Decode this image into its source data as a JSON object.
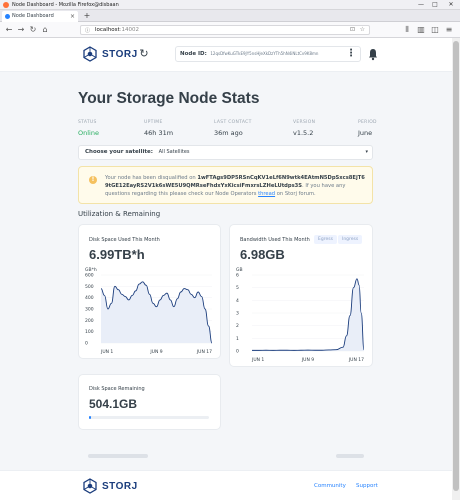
{
  "window": {
    "title": "Node Dashboard - Mozilla Firefox@disbaan",
    "min": "—",
    "max": "□",
    "close": "✕"
  },
  "browser": {
    "tab_title": "Node Dashboard",
    "tab_close": "×",
    "new_tab": "+",
    "url_host": "localhost",
    "url_port": ":14002",
    "back": "←",
    "forward": "→",
    "reload": "↻",
    "home": "⌂",
    "bookmark": "☆",
    "pocket": "⊡",
    "menu": "≡"
  },
  "header": {
    "brand": "STORJ",
    "refresh": "↻",
    "node_id_label": "Node ID:",
    "node_id_value": "12qsDfwKuGTkE9JY5nsHJeXkDzYTh5hN4iNLtCv9K8mn",
    "more": "⋮"
  },
  "main": {
    "title": "Your Storage Node Stats",
    "stats": [
      {
        "label": "STATUS",
        "value": "Online"
      },
      {
        "label": "UPTIME",
        "value": "46h 31m"
      },
      {
        "label": "LAST CONTACT",
        "value": "36m ago"
      },
      {
        "label": "VERSION",
        "value": "v1.5.2"
      },
      {
        "label": "PERIOD",
        "value": "June"
      }
    ],
    "satellite": {
      "label": "Choose your satellite:",
      "value": "All Satellites",
      "caret": "▾"
    },
    "warning": {
      "icon": "!",
      "text_before": "Your node has been disqualified on",
      "node": "1wFTAgs9DP5RSnCqKV1eLf6N9wtk4EAtmN5DpSxcs8EjT69tGE12EayRS2V1k6sWE5U9QMRseFhdxYxKicsiFmxrsLZHeLUtdps3S",
      "text_mid": ". If you have any questions regarding this please check our Node Operators",
      "link": "thread",
      "text_after": "on Storj forum."
    },
    "section_title": "Utilization & Remaining",
    "disk_used": {
      "label": "Disk Space Used This Month",
      "value": "6.99TB*h"
    },
    "bandwidth": {
      "label": "Bandwidth Used This Month",
      "value": "6.98GB",
      "egress": "Egress",
      "ingress": "Ingress"
    },
    "disk_remaining": {
      "label": "Disk Space Remaining",
      "value": "504.1GB",
      "fill_fraction": 0.02
    }
  },
  "footer": {
    "brand": "STORJ",
    "community": "Community",
    "support": "Support"
  },
  "chart_data": [
    {
      "type": "area",
      "title": "Disk Space Used This Month",
      "ylabel": "GB*h",
      "ylim": [
        0,
        600
      ],
      "y_ticks": [
        "600",
        "500",
        "400",
        "300",
        "200",
        "100",
        "0"
      ],
      "x_ticks": [
        "JUN 1",
        "JUN 9",
        "JUN 17"
      ],
      "x": [
        1,
        1.5,
        2,
        2.5,
        3,
        3.5,
        4,
        4.5,
        5,
        5.5,
        6,
        6.5,
        7,
        7.5,
        8,
        8.5,
        9,
        9.5,
        10,
        10.5,
        11,
        11.5,
        12,
        12.5,
        13,
        13.5,
        14,
        14.5,
        15,
        15.5,
        16,
        16.5,
        17
      ],
      "values": [
        480,
        420,
        300,
        350,
        500,
        470,
        430,
        410,
        380,
        420,
        460,
        520,
        540,
        510,
        430,
        350,
        320,
        380,
        420,
        440,
        380,
        320,
        390,
        450,
        480,
        470,
        430,
        400,
        450,
        410,
        300,
        150,
        0
      ],
      "color": "#1a3c7c"
    },
    {
      "type": "area",
      "title": "Bandwidth Used This Month",
      "ylabel": "GB",
      "ylim": [
        0,
        6
      ],
      "y_ticks": [
        "6",
        "5",
        "4",
        "3",
        "2",
        "1",
        "0"
      ],
      "x_ticks": [
        "JUN 1",
        "JUN 9",
        "JUN 17"
      ],
      "x": [
        1,
        2,
        3,
        4,
        5,
        6,
        7,
        8,
        9,
        10,
        11,
        12,
        13,
        14,
        14.5,
        15,
        15.5,
        16,
        16.3,
        16.6,
        17
      ],
      "values": [
        0.05,
        0.05,
        0.06,
        0.05,
        0.06,
        0.06,
        0.05,
        0.06,
        0.07,
        0.06,
        0.06,
        0.08,
        0.1,
        0.3,
        1.2,
        2.8,
        5.0,
        5.7,
        5.2,
        3.0,
        0.1
      ],
      "color": "#1a3c7c"
    }
  ]
}
